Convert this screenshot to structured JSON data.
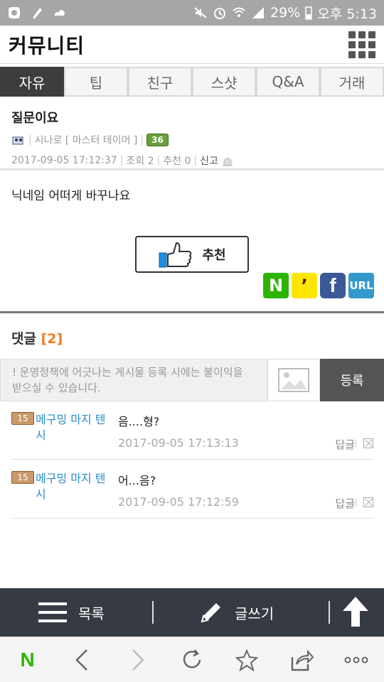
{
  "status_bar": {
    "battery": "29%",
    "time": "오후 5:13"
  },
  "header": {
    "title": "커뮤니티",
    "menu_icon": "grid-menu-icon"
  },
  "tabs": [
    {
      "label": "자유",
      "active": true
    },
    {
      "label": "팁",
      "active": false
    },
    {
      "label": "친구",
      "active": false
    },
    {
      "label": "스샷",
      "active": false
    },
    {
      "label": "Q&A",
      "active": false
    },
    {
      "label": "거래",
      "active": false
    }
  ],
  "post": {
    "title": "질문이요",
    "author": "시나로 [ 마스터 테이머 ]",
    "level": "36",
    "date": "2017-09-05 17:12:37",
    "views_label": "조회 2",
    "recommend_count_label": "추천 0",
    "report_label": "신고",
    "body": "닉네임 어떠게 바꾸나요",
    "recommend_button": "추천"
  },
  "share": {
    "naver": "N",
    "kakao": "’",
    "facebook": "f",
    "url": "URL"
  },
  "comments_section": {
    "title": "댓글",
    "count": "[2]",
    "input_placeholder": "! 운영정책에 어긋나는 게시물 등록 시에는 불이익을 받으실 수 있습니다.",
    "register_button": "등록"
  },
  "comments": [
    {
      "level": "15",
      "author": "메구밍 마지 텐 시",
      "text": "음....형?",
      "date": "2017-09-05 17:13:13",
      "reply": "답글"
    },
    {
      "level": "15",
      "author": "메구밍 마지 텐 시",
      "text": "어...음?",
      "date": "2017-09-05 17:12:59",
      "reply": "답글"
    }
  ],
  "action_bar": {
    "list_label": "목록",
    "write_label": "글쓰기"
  },
  "colors": {
    "accent_orange": "#ee7e22",
    "link_blue": "#2a8bc7",
    "action_bar_bg": "#363a42",
    "tab_active_bg": "#3d3d3d"
  }
}
